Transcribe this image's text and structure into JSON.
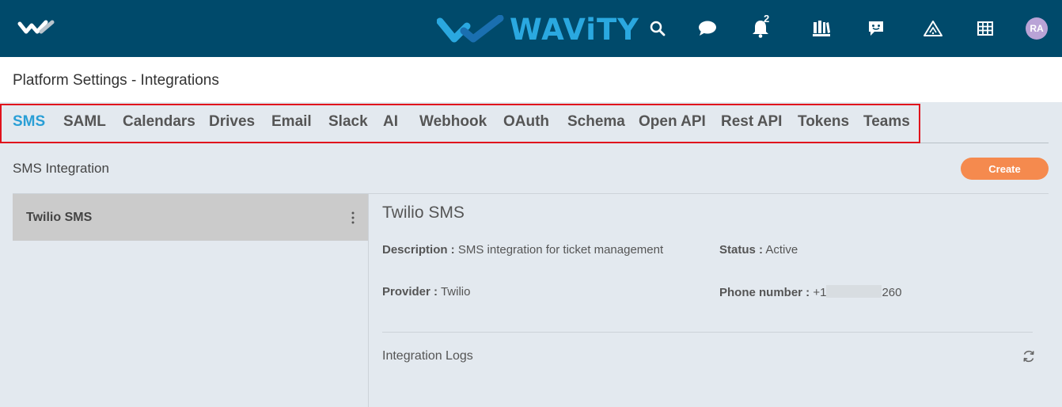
{
  "header": {
    "brand_name": "WAViTY",
    "notification_count": "2",
    "avatar_initials": "RA",
    "icons": [
      "home-logo-icon",
      "search-icon",
      "chat-icon",
      "bell-icon",
      "library-icon",
      "feedback-icon",
      "alert-triangle-icon",
      "grid-icon"
    ],
    "colors": {
      "bar": "#004a6b",
      "brand": "#2aa8e0",
      "avatar": "#b9a3d6"
    }
  },
  "page": {
    "title": "Platform Settings - Integrations"
  },
  "tabs": [
    {
      "label": "SMS",
      "active": true
    },
    {
      "label": "SAML"
    },
    {
      "label": "Calendars"
    },
    {
      "label": "Drives"
    },
    {
      "label": "Email"
    },
    {
      "label": "Slack"
    },
    {
      "label": "AI"
    },
    {
      "label": "Webhook"
    },
    {
      "label": "OAuth"
    },
    {
      "label": "Schema"
    },
    {
      "label": "Open API"
    },
    {
      "label": "Rest API"
    },
    {
      "label": "Tokens"
    },
    {
      "label": "Teams"
    }
  ],
  "section": {
    "title": "SMS Integration",
    "create_label": "Create",
    "accent": "#f58a4e"
  },
  "list": {
    "items": [
      {
        "label": "Twilio SMS",
        "selected": true
      }
    ]
  },
  "detail": {
    "title": "Twilio SMS",
    "description_key": "Description :",
    "description_value": "SMS integration for ticket management",
    "status_key": "Status :",
    "status_value": "Active",
    "provider_key": "Provider :",
    "provider_value": "Twilio",
    "phone_key": "Phone number :",
    "phone_prefix": "+1",
    "phone_suffix": "260",
    "logs_label": "Integration Logs"
  }
}
